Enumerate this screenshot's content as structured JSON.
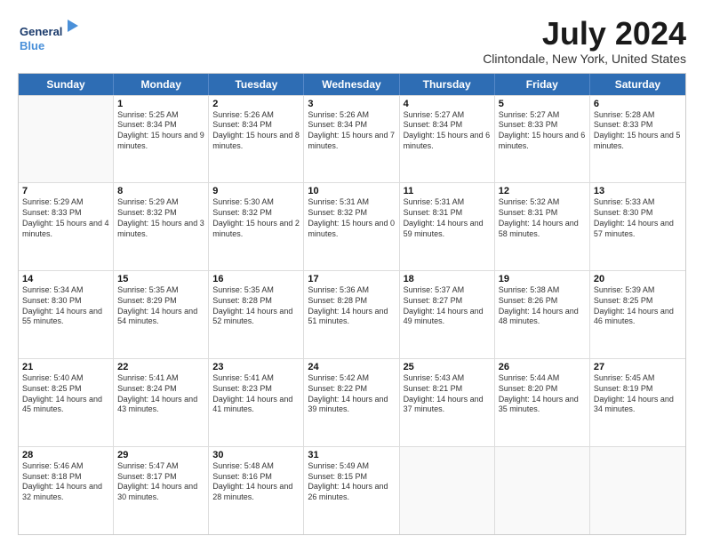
{
  "logo": {
    "line1": "General",
    "line2": "Blue"
  },
  "title": "July 2024",
  "subtitle": "Clintondale, New York, United States",
  "headers": [
    "Sunday",
    "Monday",
    "Tuesday",
    "Wednesday",
    "Thursday",
    "Friday",
    "Saturday"
  ],
  "weeks": [
    [
      {
        "day": "",
        "sunrise": "",
        "sunset": "",
        "daylight": ""
      },
      {
        "day": "1",
        "sunrise": "Sunrise: 5:25 AM",
        "sunset": "Sunset: 8:34 PM",
        "daylight": "Daylight: 15 hours and 9 minutes."
      },
      {
        "day": "2",
        "sunrise": "Sunrise: 5:26 AM",
        "sunset": "Sunset: 8:34 PM",
        "daylight": "Daylight: 15 hours and 8 minutes."
      },
      {
        "day": "3",
        "sunrise": "Sunrise: 5:26 AM",
        "sunset": "Sunset: 8:34 PM",
        "daylight": "Daylight: 15 hours and 7 minutes."
      },
      {
        "day": "4",
        "sunrise": "Sunrise: 5:27 AM",
        "sunset": "Sunset: 8:34 PM",
        "daylight": "Daylight: 15 hours and 6 minutes."
      },
      {
        "day": "5",
        "sunrise": "Sunrise: 5:27 AM",
        "sunset": "Sunset: 8:33 PM",
        "daylight": "Daylight: 15 hours and 6 minutes."
      },
      {
        "day": "6",
        "sunrise": "Sunrise: 5:28 AM",
        "sunset": "Sunset: 8:33 PM",
        "daylight": "Daylight: 15 hours and 5 minutes."
      }
    ],
    [
      {
        "day": "7",
        "sunrise": "Sunrise: 5:29 AM",
        "sunset": "Sunset: 8:33 PM",
        "daylight": "Daylight: 15 hours and 4 minutes."
      },
      {
        "day": "8",
        "sunrise": "Sunrise: 5:29 AM",
        "sunset": "Sunset: 8:32 PM",
        "daylight": "Daylight: 15 hours and 3 minutes."
      },
      {
        "day": "9",
        "sunrise": "Sunrise: 5:30 AM",
        "sunset": "Sunset: 8:32 PM",
        "daylight": "Daylight: 15 hours and 2 minutes."
      },
      {
        "day": "10",
        "sunrise": "Sunrise: 5:31 AM",
        "sunset": "Sunset: 8:32 PM",
        "daylight": "Daylight: 15 hours and 0 minutes."
      },
      {
        "day": "11",
        "sunrise": "Sunrise: 5:31 AM",
        "sunset": "Sunset: 8:31 PM",
        "daylight": "Daylight: 14 hours and 59 minutes."
      },
      {
        "day": "12",
        "sunrise": "Sunrise: 5:32 AM",
        "sunset": "Sunset: 8:31 PM",
        "daylight": "Daylight: 14 hours and 58 minutes."
      },
      {
        "day": "13",
        "sunrise": "Sunrise: 5:33 AM",
        "sunset": "Sunset: 8:30 PM",
        "daylight": "Daylight: 14 hours and 57 minutes."
      }
    ],
    [
      {
        "day": "14",
        "sunrise": "Sunrise: 5:34 AM",
        "sunset": "Sunset: 8:30 PM",
        "daylight": "Daylight: 14 hours and 55 minutes."
      },
      {
        "day": "15",
        "sunrise": "Sunrise: 5:35 AM",
        "sunset": "Sunset: 8:29 PM",
        "daylight": "Daylight: 14 hours and 54 minutes."
      },
      {
        "day": "16",
        "sunrise": "Sunrise: 5:35 AM",
        "sunset": "Sunset: 8:28 PM",
        "daylight": "Daylight: 14 hours and 52 minutes."
      },
      {
        "day": "17",
        "sunrise": "Sunrise: 5:36 AM",
        "sunset": "Sunset: 8:28 PM",
        "daylight": "Daylight: 14 hours and 51 minutes."
      },
      {
        "day": "18",
        "sunrise": "Sunrise: 5:37 AM",
        "sunset": "Sunset: 8:27 PM",
        "daylight": "Daylight: 14 hours and 49 minutes."
      },
      {
        "day": "19",
        "sunrise": "Sunrise: 5:38 AM",
        "sunset": "Sunset: 8:26 PM",
        "daylight": "Daylight: 14 hours and 48 minutes."
      },
      {
        "day": "20",
        "sunrise": "Sunrise: 5:39 AM",
        "sunset": "Sunset: 8:25 PM",
        "daylight": "Daylight: 14 hours and 46 minutes."
      }
    ],
    [
      {
        "day": "21",
        "sunrise": "Sunrise: 5:40 AM",
        "sunset": "Sunset: 8:25 PM",
        "daylight": "Daylight: 14 hours and 45 minutes."
      },
      {
        "day": "22",
        "sunrise": "Sunrise: 5:41 AM",
        "sunset": "Sunset: 8:24 PM",
        "daylight": "Daylight: 14 hours and 43 minutes."
      },
      {
        "day": "23",
        "sunrise": "Sunrise: 5:41 AM",
        "sunset": "Sunset: 8:23 PM",
        "daylight": "Daylight: 14 hours and 41 minutes."
      },
      {
        "day": "24",
        "sunrise": "Sunrise: 5:42 AM",
        "sunset": "Sunset: 8:22 PM",
        "daylight": "Daylight: 14 hours and 39 minutes."
      },
      {
        "day": "25",
        "sunrise": "Sunrise: 5:43 AM",
        "sunset": "Sunset: 8:21 PM",
        "daylight": "Daylight: 14 hours and 37 minutes."
      },
      {
        "day": "26",
        "sunrise": "Sunrise: 5:44 AM",
        "sunset": "Sunset: 8:20 PM",
        "daylight": "Daylight: 14 hours and 35 minutes."
      },
      {
        "day": "27",
        "sunrise": "Sunrise: 5:45 AM",
        "sunset": "Sunset: 8:19 PM",
        "daylight": "Daylight: 14 hours and 34 minutes."
      }
    ],
    [
      {
        "day": "28",
        "sunrise": "Sunrise: 5:46 AM",
        "sunset": "Sunset: 8:18 PM",
        "daylight": "Daylight: 14 hours and 32 minutes."
      },
      {
        "day": "29",
        "sunrise": "Sunrise: 5:47 AM",
        "sunset": "Sunset: 8:17 PM",
        "daylight": "Daylight: 14 hours and 30 minutes."
      },
      {
        "day": "30",
        "sunrise": "Sunrise: 5:48 AM",
        "sunset": "Sunset: 8:16 PM",
        "daylight": "Daylight: 14 hours and 28 minutes."
      },
      {
        "day": "31",
        "sunrise": "Sunrise: 5:49 AM",
        "sunset": "Sunset: 8:15 PM",
        "daylight": "Daylight: 14 hours and 26 minutes."
      },
      {
        "day": "",
        "sunrise": "",
        "sunset": "",
        "daylight": ""
      },
      {
        "day": "",
        "sunrise": "",
        "sunset": "",
        "daylight": ""
      },
      {
        "day": "",
        "sunrise": "",
        "sunset": "",
        "daylight": ""
      }
    ]
  ]
}
